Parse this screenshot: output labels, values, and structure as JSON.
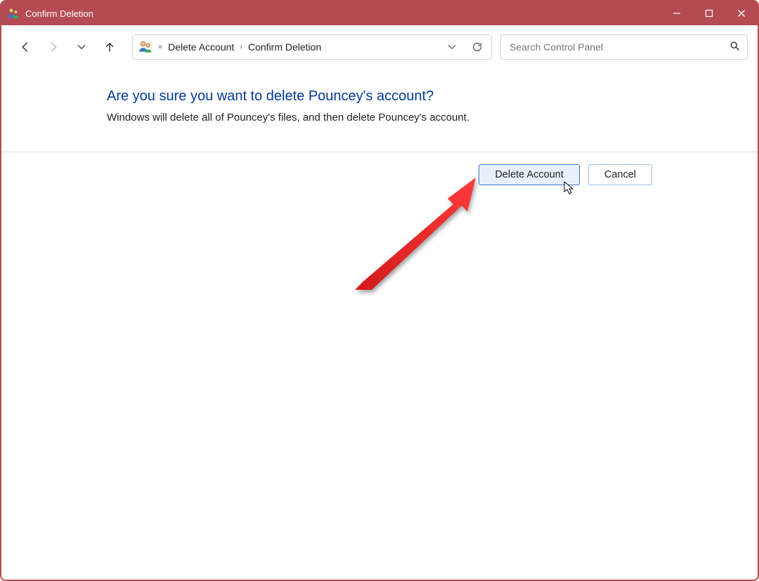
{
  "window": {
    "title": "Confirm Deletion"
  },
  "breadcrumb": {
    "seg1": "Delete Account",
    "seg2": "Confirm Deletion"
  },
  "search": {
    "placeholder": "Search Control Panel"
  },
  "main": {
    "heading": "Are you sure you want to delete Pouncey's account?",
    "subtext": "Windows will delete all of Pouncey's files, and then delete Pouncey's account."
  },
  "buttons": {
    "primary": "Delete Account",
    "secondary": "Cancel"
  }
}
